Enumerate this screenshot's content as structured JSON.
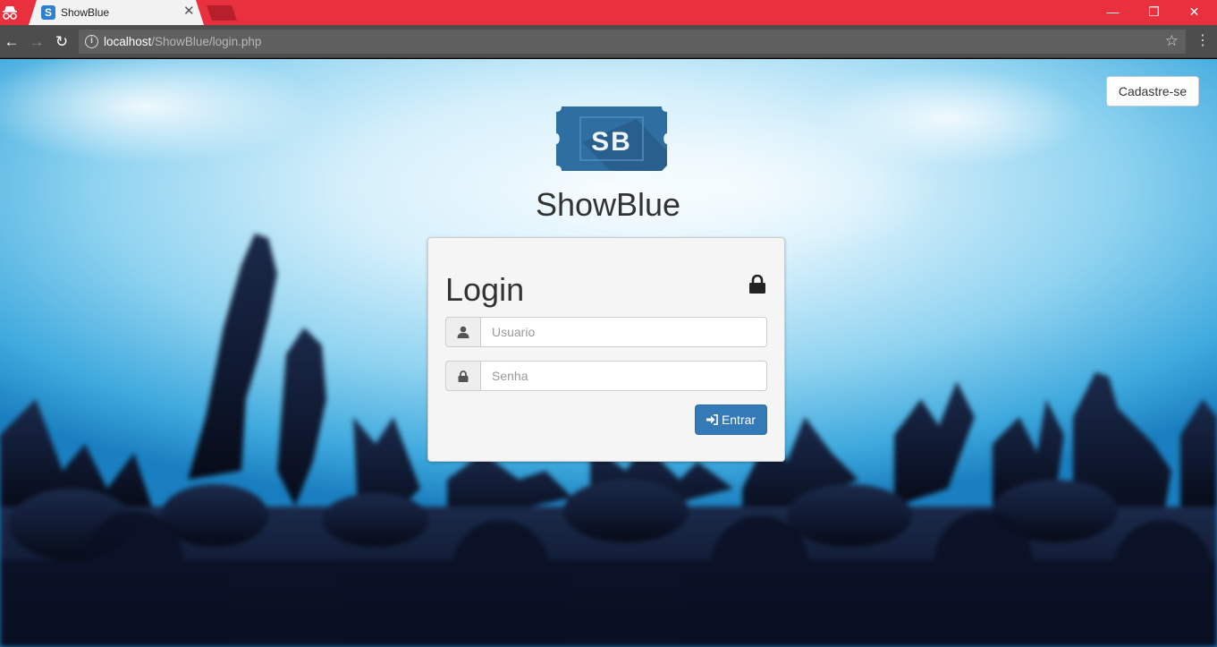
{
  "browser": {
    "tab_title": "ShowBlue",
    "tab_favicon": "S",
    "url_host": "localhost",
    "url_path": "/ShowBlue/login.php",
    "theme_color": "#e8303f"
  },
  "icons": {
    "incognito": "incognito-icon",
    "back": "arrow-left-icon",
    "forward": "arrow-right-icon",
    "reload": "reload-icon",
    "info": "info-icon",
    "bookmark": "star-icon",
    "menu": "kebab-menu-icon",
    "user": "user-icon",
    "lock": "lock-icon",
    "signin": "sign-in-icon"
  },
  "page": {
    "signup_label": "Cadastre-se",
    "logo_text": "SB",
    "brand_name": "ShowBlue",
    "login": {
      "title": "Login",
      "username_placeholder": "Usuario",
      "password_placeholder": "Senha",
      "submit_label": "Entrar"
    }
  },
  "colors": {
    "primary_button": "#337ab7",
    "logo_blue": "#2e6ea1"
  }
}
